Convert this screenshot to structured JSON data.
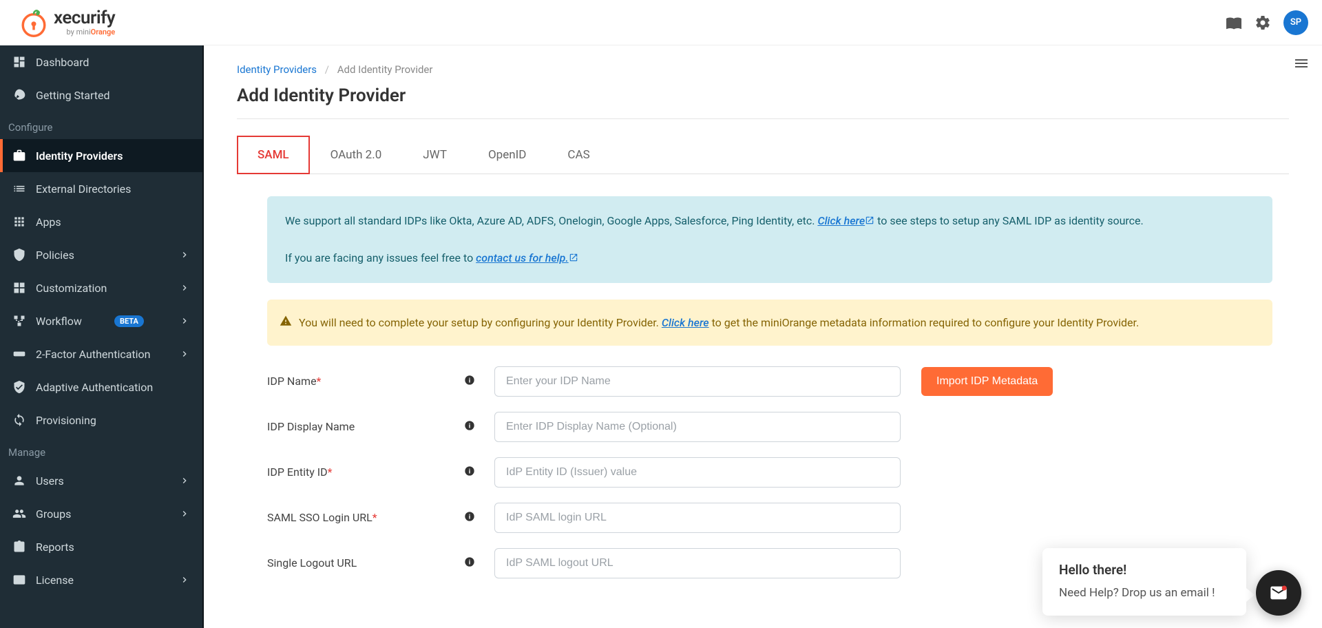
{
  "brand": {
    "name": "xecurify",
    "by": "by mini",
    "by_accent": "Orange"
  },
  "header": {
    "avatar": "SP"
  },
  "sidebar": {
    "dashboard": "Dashboard",
    "getting_started": "Getting Started",
    "section_configure": "Configure",
    "identity_providers": "Identity Providers",
    "external_directories": "External Directories",
    "apps": "Apps",
    "policies": "Policies",
    "customization": "Customization",
    "workflow": "Workflow",
    "workflow_badge": "BETA",
    "twofa": "2-Factor Authentication",
    "adaptive": "Adaptive Authentication",
    "provisioning": "Provisioning",
    "section_manage": "Manage",
    "users": "Users",
    "groups": "Groups",
    "reports": "Reports",
    "license": "License"
  },
  "breadcrumb": {
    "root": "Identity Providers",
    "current": "Add Identity Provider"
  },
  "page_title": "Add Identity Provider",
  "tabs": {
    "saml": "SAML",
    "oauth": "OAuth 2.0",
    "jwt": "JWT",
    "openid": "OpenID",
    "cas": "CAS"
  },
  "info_banner": {
    "line1_pre": "We support all standard IDPs like Okta, Azure AD, ADFS, Onelogin, Google Apps, Salesforce, Ping Identity, etc. ",
    "link1": "Click here",
    "line1_post": " to see steps to setup any SAML IDP as identity source.",
    "line2_pre": "If you are facing any issues feel free to ",
    "link2": "contact us for help."
  },
  "warn_banner": {
    "pre": "You will need to complete your setup by configuring your Identity Provider. ",
    "link": "Click here",
    "post": " to get the miniOrange metadata information required to configure your Identity Provider."
  },
  "form": {
    "idp_name": {
      "label": "IDP Name",
      "placeholder": "Enter your IDP Name",
      "import_btn": "Import IDP Metadata"
    },
    "idp_display": {
      "label": "IDP Display Name",
      "placeholder": "Enter IDP Display Name (Optional)"
    },
    "entity_id": {
      "label": "IDP Entity ID",
      "placeholder": "IdP Entity ID (Issuer) value"
    },
    "sso_url": {
      "label": "SAML SSO Login URL",
      "placeholder": "IdP SAML login URL"
    },
    "slo_url": {
      "label": "Single Logout URL",
      "placeholder": "IdP SAML logout URL"
    }
  },
  "chat": {
    "greeting": "Hello there!",
    "message": "Need Help? Drop us an email !"
  }
}
